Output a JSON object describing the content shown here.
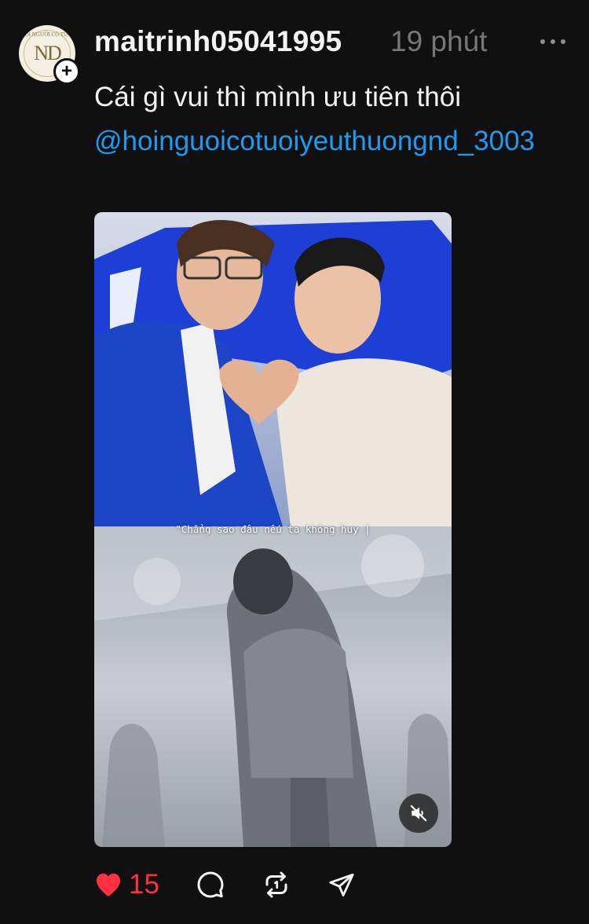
{
  "post": {
    "author": {
      "username": "maitrinh05041995",
      "avatar": {
        "monogram": "ND",
        "arc_text": "HỘI NGƯỜI CÓ TUỔI",
        "tag_text": "YÊU THƯƠNG"
      },
      "follow_symbol": "+"
    },
    "timestamp": "19 phút",
    "caption": {
      "text": "Cái gì vui thì mình ưu tiên thôi",
      "mention": "@hoinguoicotuoiyeuthuongnd_3003"
    },
    "media": {
      "type": "video",
      "subtitle": "\"Chẳng sao đâu nếu ta không huy |",
      "muted": true
    },
    "actions": {
      "like_count": "15",
      "liked": true
    }
  },
  "colors": {
    "background": "#101010",
    "text": "#f3f3f3",
    "muted_text": "#777777",
    "mention": "#1d9bf0",
    "like": "#ff3040"
  },
  "icons": [
    "more-icon",
    "plus-icon",
    "mute-icon",
    "heart-icon",
    "comment-icon",
    "repost-icon",
    "share-icon"
  ]
}
